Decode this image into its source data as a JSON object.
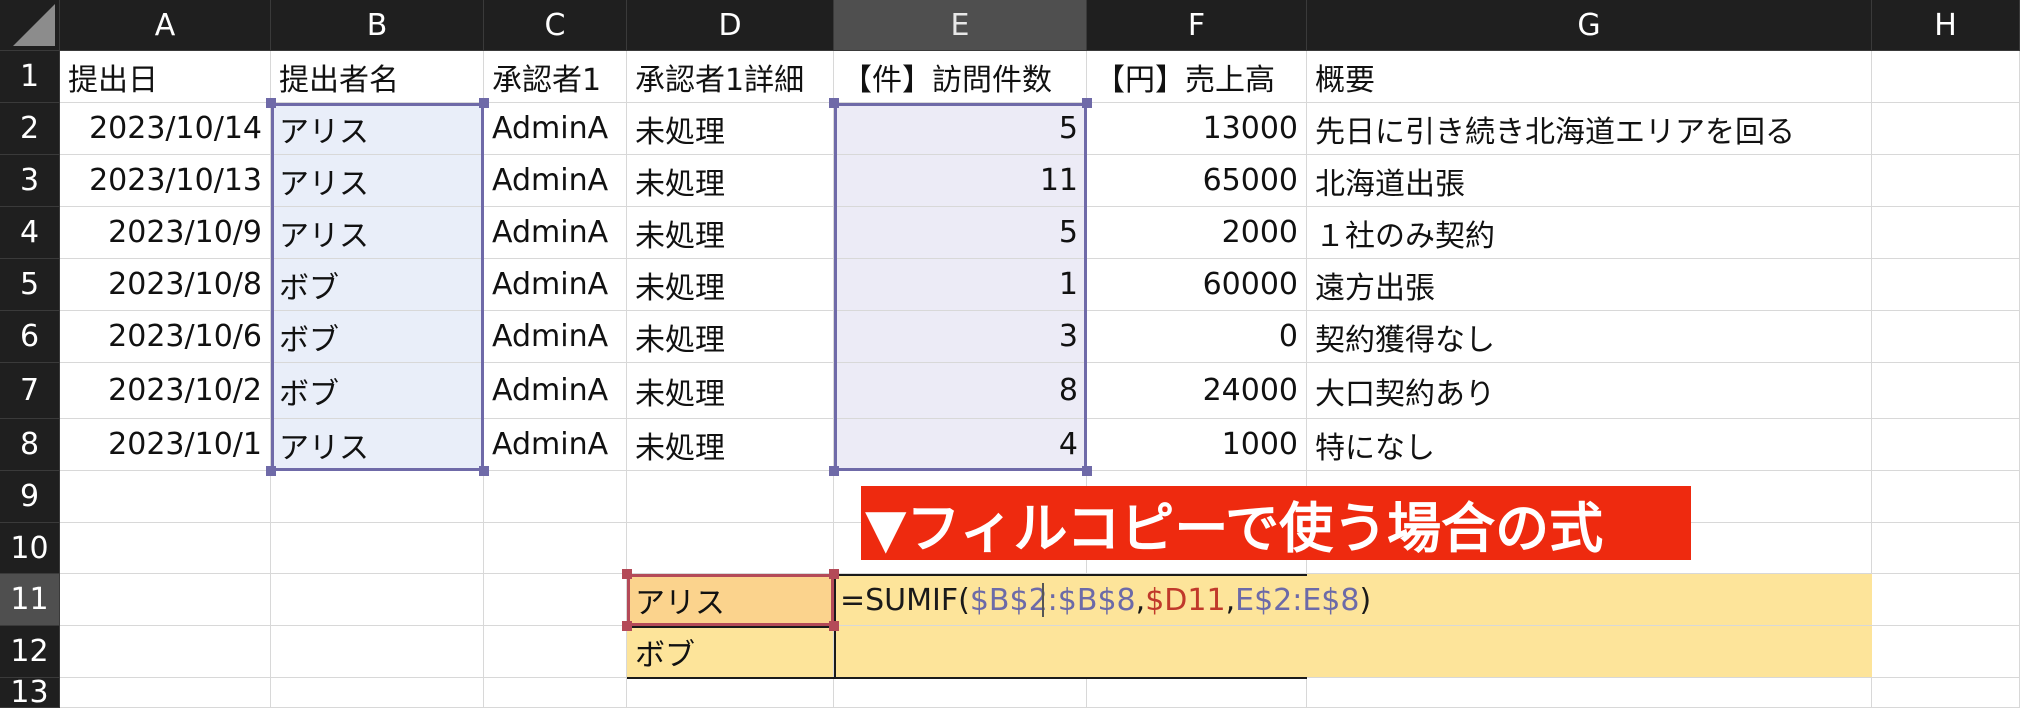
{
  "columns": [
    "A",
    "B",
    "C",
    "D",
    "E",
    "F",
    "G",
    "H"
  ],
  "rows": [
    "1",
    "2",
    "3",
    "4",
    "5",
    "6",
    "7",
    "8",
    "9",
    "10",
    "11",
    "12",
    "13"
  ],
  "header_row": {
    "A": "提出日",
    "B": "提出者名",
    "C": "承認者1",
    "D": "承認者1詳細",
    "E": "【件】訪問件数",
    "F": "【円】売上高",
    "G": "概要"
  },
  "data_rows": [
    {
      "date": "2023/10/14",
      "name": "アリス",
      "approver": "AdminA",
      "detail": "未処理",
      "visits": "5",
      "sales": "13000",
      "summary": "先日に引き続き北海道エリアを回る"
    },
    {
      "date": "2023/10/13",
      "name": "アリス",
      "approver": "AdminA",
      "detail": "未処理",
      "visits": "11",
      "sales": "65000",
      "summary": "北海道出張"
    },
    {
      "date": "2023/10/9",
      "name": "アリス",
      "approver": "AdminA",
      "detail": "未処理",
      "visits": "5",
      "sales": "2000",
      "summary": "１社のみ契約"
    },
    {
      "date": "2023/10/8",
      "name": "ボブ",
      "approver": "AdminA",
      "detail": "未処理",
      "visits": "1",
      "sales": "60000",
      "summary": "遠方出張"
    },
    {
      "date": "2023/10/6",
      "name": "ボブ",
      "approver": "AdminA",
      "detail": "未処理",
      "visits": "3",
      "sales": "0",
      "summary": "契約獲得なし"
    },
    {
      "date": "2023/10/2",
      "name": "ボブ",
      "approver": "AdminA",
      "detail": "未処理",
      "visits": "8",
      "sales": "24000",
      "summary": "大口契約あり"
    },
    {
      "date": "2023/10/1",
      "name": "アリス",
      "approver": "AdminA",
      "detail": "未処理",
      "visits": "4",
      "sales": "1000",
      "summary": "特になし"
    }
  ],
  "lookup": {
    "D11": "アリス",
    "D12": "ボブ"
  },
  "banner": "▼フィルコピーで使う場合の式",
  "formula": {
    "prefix": "=SUMIF(",
    "range1": "$B$2:$B$8",
    "comma1": ",",
    "criteria": "$D11",
    "comma2": ",",
    "range2": "E$2:E$8",
    "suffix": ")"
  },
  "colors": {
    "header_bg": "#1f1f1f",
    "selection_border": "#6f6aa8",
    "criteria_red": "#c0392b",
    "banner_red": "#ee2a0f",
    "formula_yellow": "#fde49a"
  }
}
